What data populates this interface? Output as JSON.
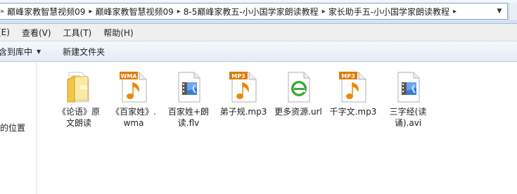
{
  "address": {
    "crumbs": [
      "巅峰家教智慧视频09",
      "巅峰家教智慧视频09",
      "8-5巅峰家教五-小小国学家朗读教程",
      "家长助手五-小小国学家朗读教程"
    ],
    "separator": "»",
    "crumb_separator": "▸",
    "dropdown": "▼"
  },
  "menu": {
    "items": [
      "(E)",
      "查看(V)",
      "工具(T)",
      "帮助(H)"
    ]
  },
  "toolbar": {
    "include_label": "含到库中",
    "include_caret": "▼",
    "new_folder_label": "新建文件夹"
  },
  "navpane": {
    "label": "的位置"
  },
  "files": [
    {
      "name": "《论语》原文朗读",
      "type": "folder"
    },
    {
      "name": "《百家姓》.wma",
      "type": "wma",
      "badge": "WMA"
    },
    {
      "name": "百家姓+朗读.flv",
      "type": "video"
    },
    {
      "name": "弟子规.mp3",
      "type": "mp3",
      "badge": "MP3"
    },
    {
      "name": "更多资源.url",
      "type": "url"
    },
    {
      "name": "千字文.mp3",
      "type": "mp3",
      "badge": "MP3"
    },
    {
      "name": "三字经(读诵).avi",
      "type": "video"
    }
  ],
  "colors": {
    "folder": "#f2c84b",
    "audio_badge": "#e07b00",
    "note": "#e8890c",
    "video_film": "#3a7bd5",
    "url_green": "#3fa83a"
  }
}
